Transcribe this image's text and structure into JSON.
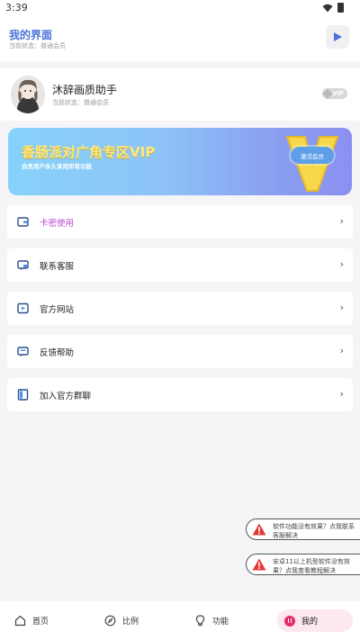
{
  "status_bar": {
    "time": "3:39"
  },
  "header": {
    "title": "我的界面",
    "subtitle": "当前状态：普通会员"
  },
  "profile": {
    "name": "沐辞画质助手",
    "status": "当前状态：普通会员",
    "badge": "VIP"
  },
  "vip_banner": {
    "title": "香肠派对广角专区VIP",
    "description": "会员用户永久享用所有功能",
    "button_label": "激活会员"
  },
  "menu": [
    {
      "label": "卡密使用",
      "icon": "wallet-icon",
      "accent": true
    },
    {
      "label": "联系客服",
      "icon": "chat-icon"
    },
    {
      "label": "官方网站",
      "icon": "website-icon"
    },
    {
      "label": "反馈帮助",
      "icon": "feedback-icon"
    },
    {
      "label": "加入官方群聊",
      "icon": "group-chat-icon"
    }
  ],
  "toasts": [
    {
      "text": "软件功能没有效果？点我联系客服解决",
      "icon": "warning-icon"
    },
    {
      "text": "安卓11以上机型软件没有效果？点我查看教程解决",
      "icon": "warning-icon"
    }
  ],
  "bottom_nav": [
    {
      "label": "首页",
      "icon": "home-icon"
    },
    {
      "label": "比例",
      "icon": "compass-icon"
    },
    {
      "label": "功能",
      "icon": "lightbulb-icon"
    },
    {
      "label": "我的",
      "icon": "profile-icon",
      "active": true
    }
  ],
  "colors": {
    "accent": "#4a74d8",
    "menu_accent": "#b64ad6",
    "active_nav": "#e72a6a",
    "warning": "#e53935"
  }
}
